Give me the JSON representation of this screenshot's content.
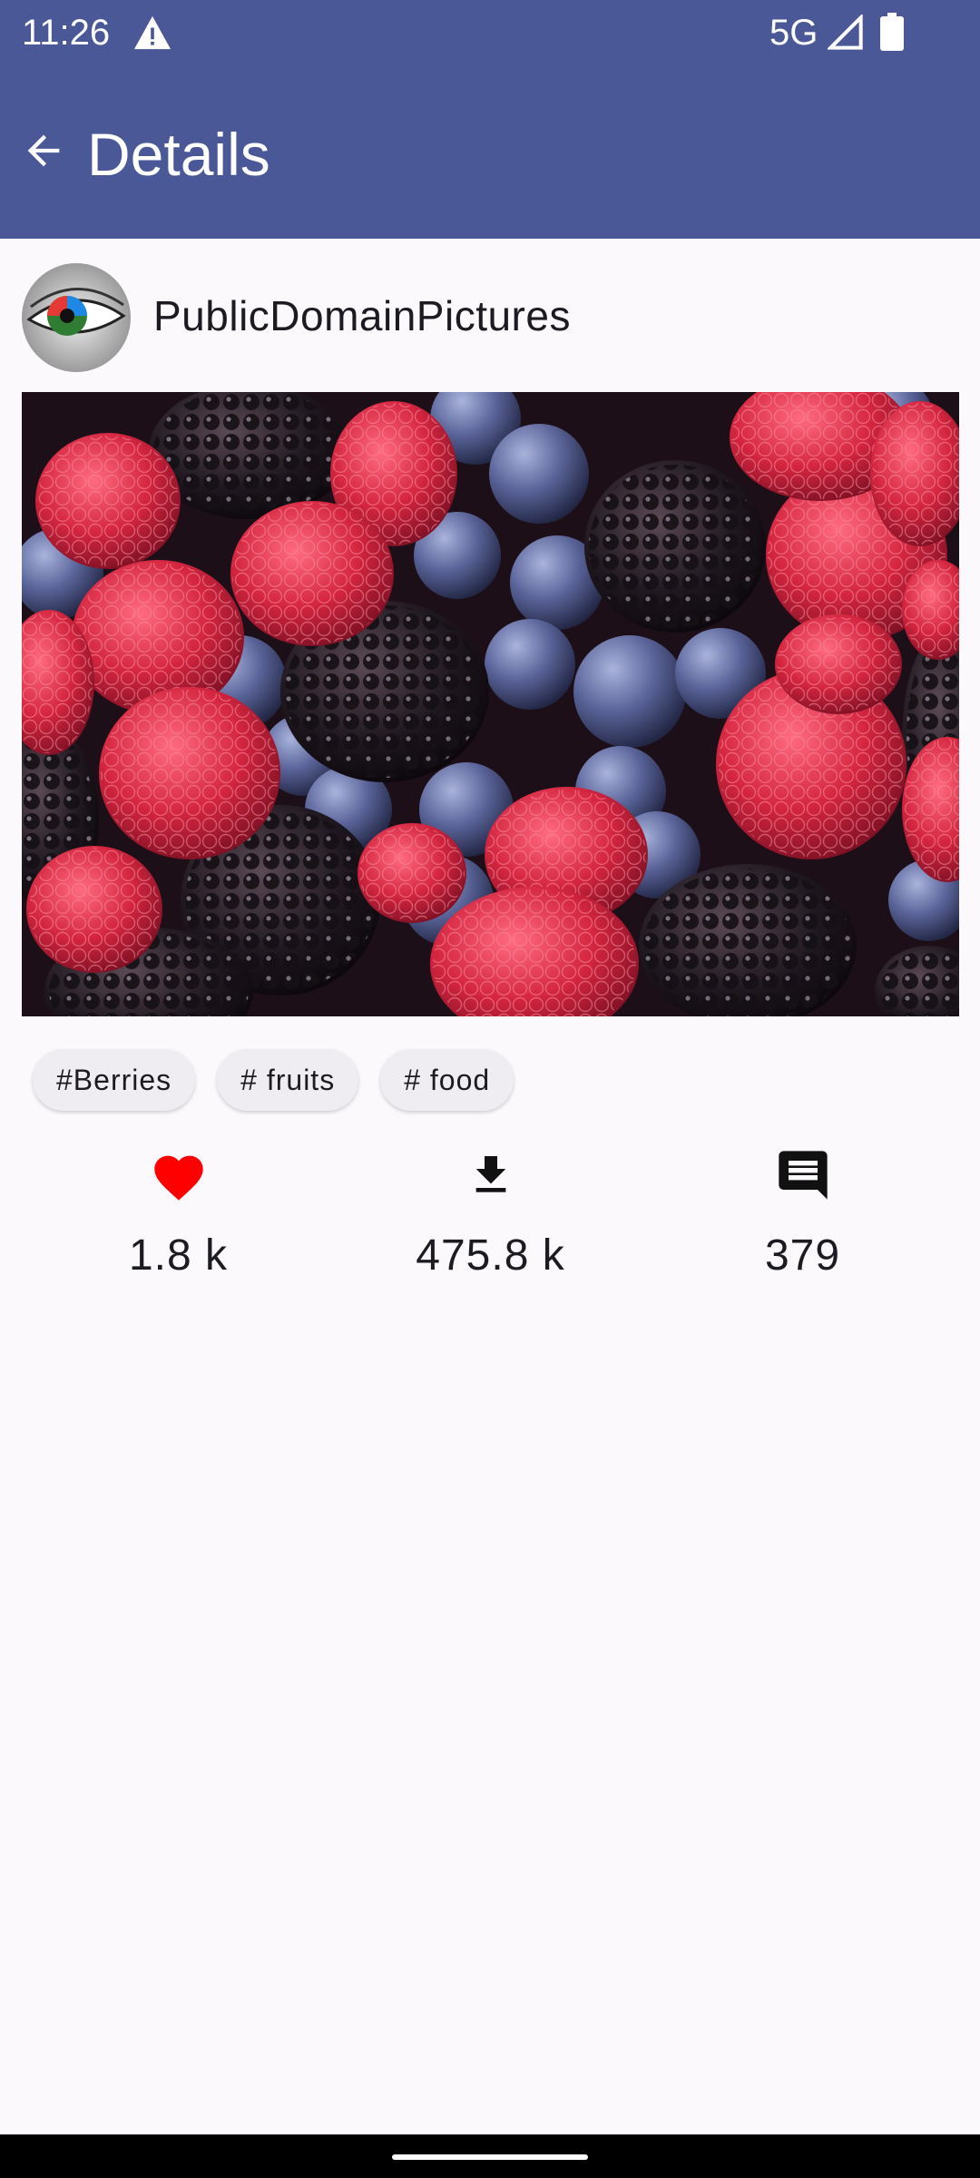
{
  "status_bar": {
    "time": "11:26",
    "network": "5G"
  },
  "app_bar": {
    "title": "Details"
  },
  "user": {
    "name": "PublicDomainPictures"
  },
  "tags": [
    "#Berries",
    "# fruits",
    "# food"
  ],
  "stats": {
    "likes": "1.8 k",
    "downloads": "475.8 k",
    "comments": "379"
  },
  "colors": {
    "app_bar": "#4a5897",
    "background": "#fcf9fd",
    "like_heart": "#ff0000",
    "chip_bg": "#f0edf2"
  },
  "icons": [
    "warning-icon",
    "signal-icon",
    "battery-icon",
    "back-arrow-icon",
    "heart-icon",
    "download-icon",
    "comment-icon"
  ]
}
